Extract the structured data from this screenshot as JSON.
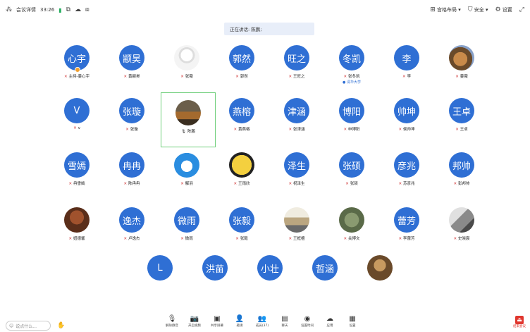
{
  "topbar": {
    "meeting_info": "会议详情",
    "timer": "33:26",
    "layout": "宫格布局",
    "security": "安全",
    "settings": "设置"
  },
  "speaking_banner": "正在讲话: 陈鹏;",
  "participants": [
    {
      "avatar_text": "心宇",
      "name": "主持-姜心宇",
      "host": true
    },
    {
      "avatar_text": "颛昊",
      "name": "黄颛昊"
    },
    {
      "avatar_text": "",
      "name": "张薇",
      "photo": "sketch"
    },
    {
      "avatar_text": "郭然",
      "name": "郭然"
    },
    {
      "avatar_text": "旺之",
      "name": "王旺之"
    },
    {
      "avatar_text": "冬凯",
      "name": "张冬凯",
      "sub": "清华大学"
    },
    {
      "avatar_text": "李",
      "name": "李"
    },
    {
      "avatar_text": "",
      "name": "姜薇",
      "photo": "dog"
    },
    {
      "avatar_text": "V",
      "name": "v"
    },
    {
      "avatar_text": "张璇",
      "name": "张璇"
    },
    {
      "avatar_text": "",
      "name": "陈鹏",
      "photo": "car",
      "selected": true
    },
    {
      "avatar_text": "燕榕",
      "name": "黄燕榕"
    },
    {
      "avatar_text": "津涵",
      "name": "张津涵"
    },
    {
      "avatar_text": "博阳",
      "name": "申博阳"
    },
    {
      "avatar_text": "帅坤",
      "name": "侯帅坤"
    },
    {
      "avatar_text": "王卓",
      "name": "王卓"
    },
    {
      "avatar_text": "雪嫣",
      "name": "冉雪嫣"
    },
    {
      "avatar_text": "冉冉",
      "name": "陈冉冉"
    },
    {
      "avatar_text": "",
      "name": "解羽",
      "photo": "doraemon"
    },
    {
      "avatar_text": "",
      "name": "王雨欣",
      "photo": "duck"
    },
    {
      "avatar_text": "泽生",
      "name": "祝泽生"
    },
    {
      "avatar_text": "张硕",
      "name": "张硕"
    },
    {
      "avatar_text": "彦兆",
      "name": "苏彦兆"
    },
    {
      "avatar_text": "邦帅",
      "name": "彭邦帅"
    },
    {
      "avatar_text": "",
      "name": "妞德馨",
      "photo": "dark"
    },
    {
      "avatar_text": "逸杰",
      "name": "卢逸杰"
    },
    {
      "avatar_text": "微雨",
      "name": "微雨"
    },
    {
      "avatar_text": "张毅",
      "name": "张毅"
    },
    {
      "avatar_text": "",
      "name": "王框檀",
      "photo": "vehicle"
    },
    {
      "avatar_text": "",
      "name": "关博文",
      "photo": "field"
    },
    {
      "avatar_text": "蕾芳",
      "name": "李蕾芳"
    },
    {
      "avatar_text": "",
      "name": "史晓宸",
      "photo": "gray"
    },
    {
      "avatar_text": "L",
      "name": ""
    },
    {
      "avatar_text": "洪苗",
      "name": ""
    },
    {
      "avatar_text": "小壮",
      "name": ""
    },
    {
      "avatar_text": "哲涵",
      "name": ""
    },
    {
      "avatar_text": "",
      "name": "",
      "photo": "brown"
    }
  ],
  "chat": {
    "placeholder": "说点什么..."
  },
  "toolbar": [
    {
      "label": "解除静音",
      "icon": "mic-icon"
    },
    {
      "label": "开启视频",
      "icon": "camera-icon"
    },
    {
      "label": "共享屏幕",
      "icon": "screen-share-icon"
    },
    {
      "label": "邀请",
      "icon": "invite-icon"
    },
    {
      "label": "成员(37)",
      "icon": "members-icon"
    },
    {
      "label": "聊天",
      "icon": "chat-icon"
    },
    {
      "label": "设置时间",
      "icon": "record-icon"
    },
    {
      "label": "应用",
      "icon": "apps-icon"
    },
    {
      "label": "设置",
      "icon": "settings-icon"
    }
  ],
  "leave_label": "结束会议"
}
